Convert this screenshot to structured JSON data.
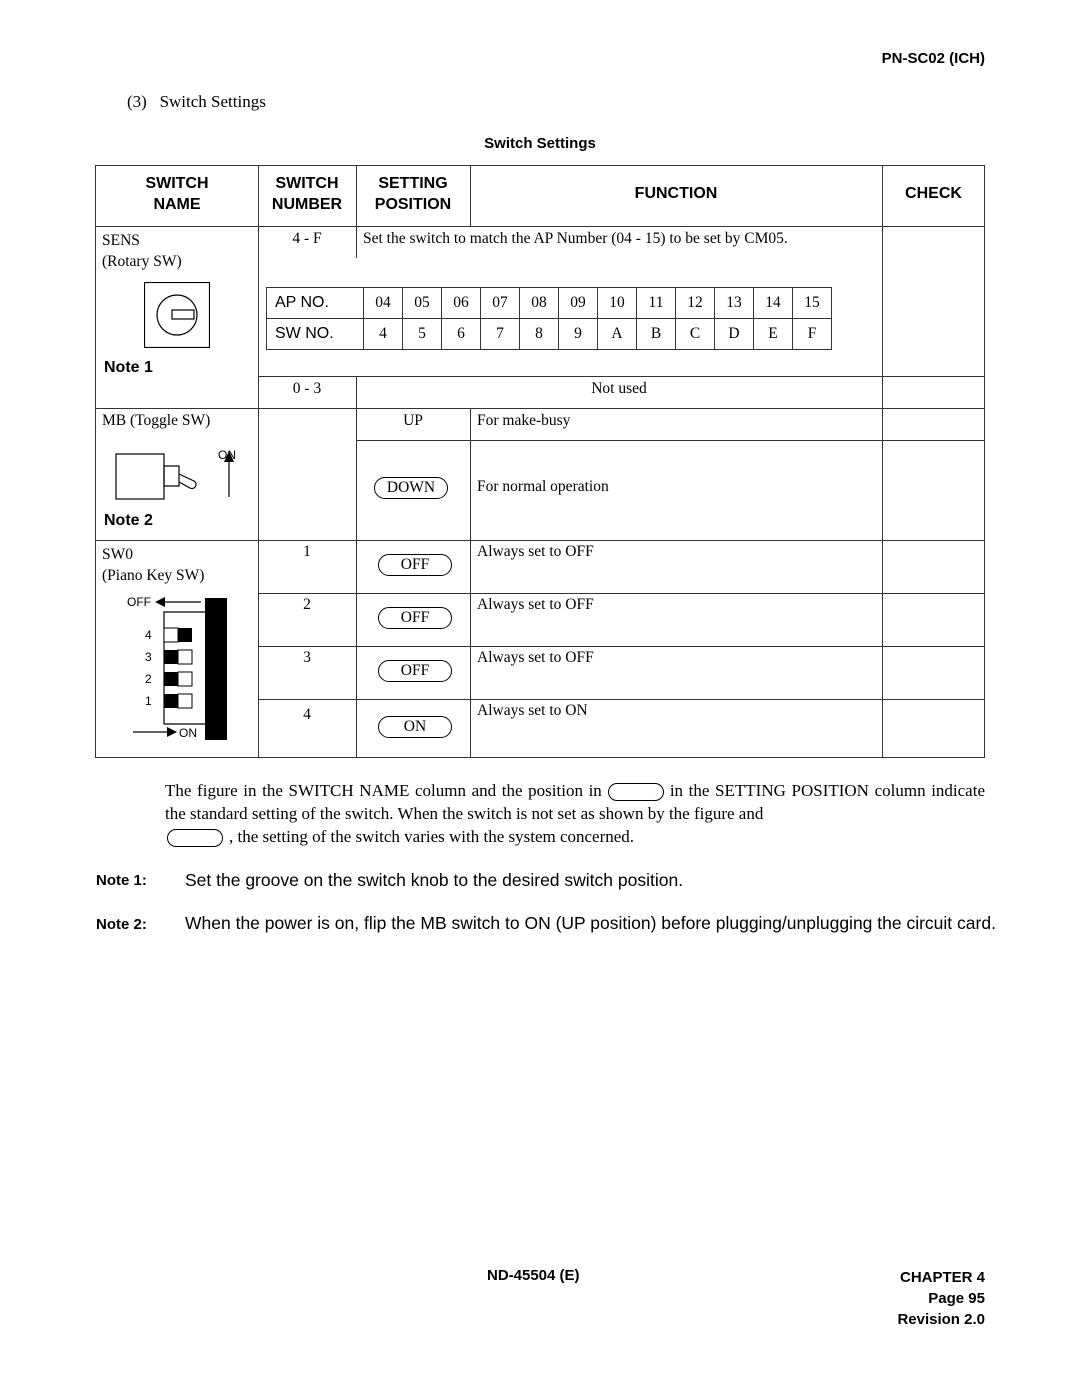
{
  "header": {
    "doc_id": "PN-SC02 (ICH)"
  },
  "section": {
    "number": "(3)",
    "title": "Switch Settings"
  },
  "table": {
    "title": "Switch Settings",
    "columns": {
      "name_l1": "SWITCH",
      "name_l2": "NAME",
      "number_l1": "SWITCH",
      "number_l2": "NUMBER",
      "position_l1": "SETTING",
      "position_l2": "POSITION",
      "function": "FUNCTION",
      "check": "CHECK"
    },
    "sens": {
      "name": "SENS",
      "type": "(Rotary SW)",
      "note": "Note 1",
      "rows": [
        {
          "number": "4 - F",
          "function": "Set the switch to match the AP Number (04 - 15) to be set by CM05."
        },
        {
          "number": "0 - 3",
          "function": "Not used"
        }
      ],
      "map": {
        "ap_label": "AP NO.",
        "sw_label": "SW NO.",
        "ap": [
          "04",
          "05",
          "06",
          "07",
          "08",
          "09",
          "10",
          "11",
          "12",
          "13",
          "14",
          "15"
        ],
        "sw": [
          "4",
          "5",
          "6",
          "7",
          "8",
          "9",
          "A",
          "B",
          "C",
          "D",
          "E",
          "F"
        ]
      }
    },
    "mb": {
      "name": "MB (Toggle SW)",
      "on_label": "ON",
      "note": "Note 2",
      "rows": [
        {
          "position": "UP",
          "standard": false,
          "function": "For make-busy"
        },
        {
          "position": "DOWN",
          "standard": true,
          "function": "For normal operation"
        }
      ]
    },
    "sw0": {
      "name": "SW0",
      "type": "(Piano Key SW)",
      "off_label": "OFF",
      "on_label": "ON",
      "key_labels": [
        "4",
        "3",
        "2",
        "1"
      ],
      "rows": [
        {
          "number": "1",
          "position": "OFF",
          "standard": true,
          "function": "Always set to OFF"
        },
        {
          "number": "2",
          "position": "OFF",
          "standard": true,
          "function": "Always set to OFF"
        },
        {
          "number": "3",
          "position": "OFF",
          "standard": true,
          "function": "Always set to OFF"
        },
        {
          "number": "4",
          "position": "ON",
          "standard": true,
          "function": "Always set to ON"
        }
      ]
    }
  },
  "explanation": {
    "part1": "The figure in the SWITCH NAME column and the position in",
    "part2": "in the SETTING POSITION column indicate the standard setting of the switch. When the switch is not set as shown by the figure and",
    "part3": ", the setting of the switch varies with the system concerned."
  },
  "notes": [
    {
      "label": "Note 1:",
      "text": "Set the groove on the switch knob to the desired switch position."
    },
    {
      "label": "Note 2:",
      "text": "When the power is on, flip the MB switch to ON (UP position) before plugging/unplugging the circuit card."
    }
  ],
  "footer": {
    "manual": "ND-45504 (E)",
    "chapter": "CHAPTER 4",
    "page": "Page 95",
    "revision": "Revision 2.0"
  }
}
